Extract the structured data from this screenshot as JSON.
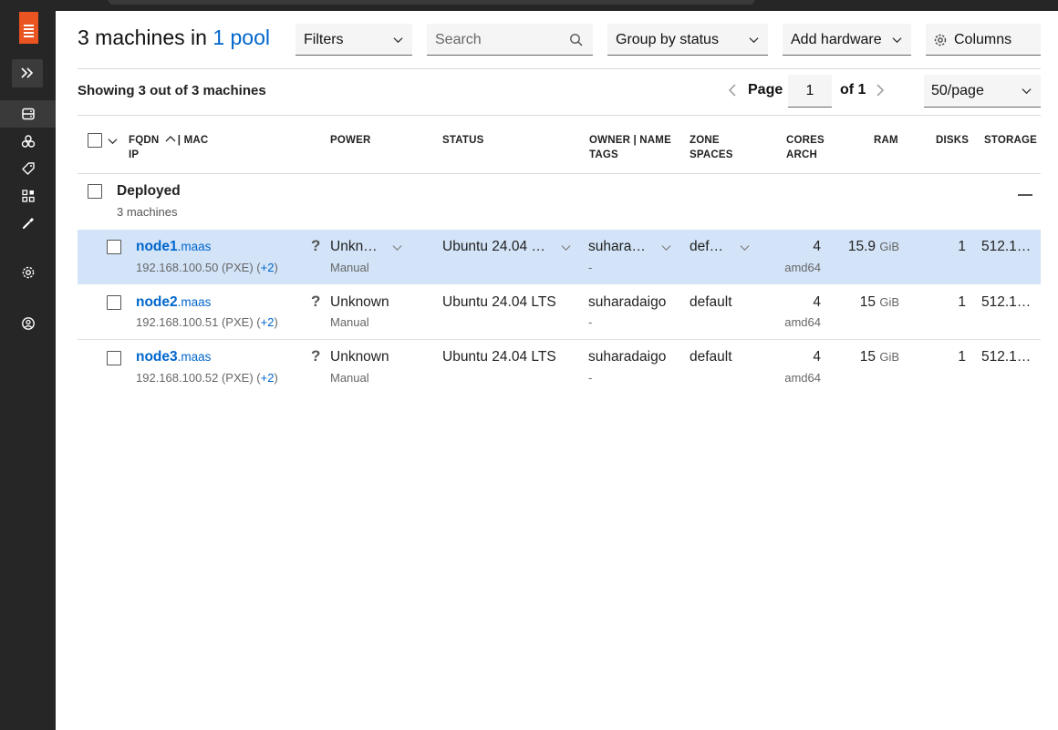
{
  "header": {
    "title_prefix": "3 machines in",
    "title_link": "1 pool",
    "filters_label": "Filters",
    "search_placeholder": "Search",
    "group_by_label": "Group by status",
    "add_hardware_label": "Add hardware",
    "columns_label": "Columns"
  },
  "pagination": {
    "showing_text": "Showing 3 out of 3 machines",
    "page_label": "Page",
    "page_value": "1",
    "of_label": "of 1",
    "per_page": "50/page"
  },
  "columns": {
    "fqdn": "FQDN",
    "mac": "| MAC",
    "ip": "IP",
    "power": "POWER",
    "status": "STATUS",
    "owner": "OWNER | NAME",
    "tags": "TAGS",
    "zone": "ZONE",
    "spaces": "SPACES",
    "cores": "CORES",
    "arch": "ARCH",
    "ram": "RAM",
    "disks": "DISKS",
    "storage": "STORAGE"
  },
  "group": {
    "title": "Deployed",
    "subtitle": "3 machines"
  },
  "machines": [
    {
      "host": "node1",
      "domain": ".maas",
      "ip": "192.168.100.50 (PXE)",
      "ip_extra_open": "(",
      "ip_extra": "+2",
      "ip_extra_close": ")",
      "power": "Unkn…",
      "power_type": "Manual",
      "status": "Ubuntu 24.04 …",
      "owner": "suhara…",
      "tags": "-",
      "zone": "def…",
      "cores": "4",
      "arch": "amd64",
      "ram": "15.9",
      "ram_unit": "GiB",
      "disks": "1",
      "storage": "512.1…"
    },
    {
      "host": "node2",
      "domain": ".maas",
      "ip": "192.168.100.51 (PXE)",
      "ip_extra_open": "(",
      "ip_extra": "+2",
      "ip_extra_close": ")",
      "power": "Unknown",
      "power_type": "Manual",
      "status": "Ubuntu 24.04 LTS",
      "owner": "suharadaigo",
      "tags": "-",
      "zone": "default",
      "cores": "4",
      "arch": "amd64",
      "ram": "15",
      "ram_unit": "GiB",
      "disks": "1",
      "storage": "512.1…"
    },
    {
      "host": "node3",
      "domain": ".maas",
      "ip": "192.168.100.52 (PXE)",
      "ip_extra_open": "(",
      "ip_extra": "+2",
      "ip_extra_close": ")",
      "power": "Unknown",
      "power_type": "Manual",
      "status": "Ubuntu 24.04 LTS",
      "owner": "suharadaigo",
      "tags": "-",
      "zone": "default",
      "cores": "4",
      "arch": "amd64",
      "ram": "15",
      "ram_unit": "GiB",
      "disks": "1",
      "storage": "512.1…"
    }
  ],
  "power_unknown_glyph": "?",
  "colors": {
    "accent": "#0066cc",
    "brand": "#e95420",
    "sidebar": "#262626",
    "selected_row": "#d3e4f8"
  },
  "sidebar_icons": [
    "expand-icon",
    "machines-icon",
    "pools-icon",
    "tags-icon",
    "zones-icon",
    "kvm-icon",
    "settings-icon",
    "account-icon"
  ]
}
